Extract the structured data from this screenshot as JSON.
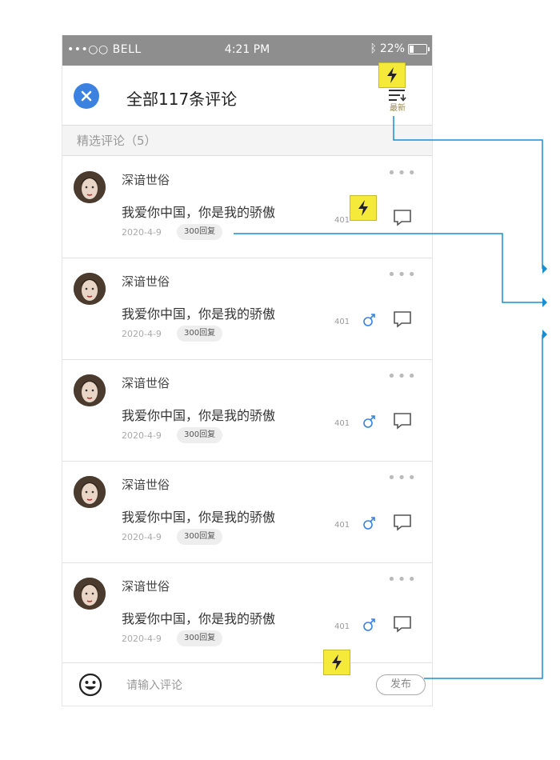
{
  "status_bar": {
    "carrier": "•••○○ BELL",
    "time": "4:21 PM",
    "battery": "22%",
    "battery_level": 0.22
  },
  "header": {
    "title": "全部117条评论",
    "sort_label": "最新"
  },
  "section": {
    "label": "精选评论（5）"
  },
  "comments": [
    {
      "username": "深谙世俗",
      "text": "我爱你中国，你是我的骄傲",
      "date": "2020-4-9",
      "replies": "300回复",
      "likes": "401"
    },
    {
      "username": "深谙世俗",
      "text": "我爱你中国，你是我的骄傲",
      "date": "2020-4-9",
      "replies": "300回复",
      "likes": "401"
    },
    {
      "username": "深谙世俗",
      "text": "我爱你中国，你是我的骄傲",
      "date": "2020-4-9",
      "replies": "300回复",
      "likes": "401"
    },
    {
      "username": "深谙世俗",
      "text": "我爱你中国，你是我的骄傲",
      "date": "2020-4-9",
      "replies": "300回复",
      "likes": "401"
    },
    {
      "username": "深谙世俗",
      "text": "我爱你中国，你是我的骄傲",
      "date": "2020-4-9",
      "replies": "300回复",
      "likes": "401"
    }
  ],
  "footer": {
    "placeholder": "请输入评论",
    "publish_label": "发布"
  },
  "colors": {
    "accent": "#3b82e0",
    "annotation_line": "#1a8fd0",
    "flash_marker": "#f5e93a",
    "status_bar": "#8e8e8e"
  },
  "icons": [
    "close-icon",
    "sort-icon",
    "more-icon",
    "like-icon",
    "reply-icon",
    "emoji-icon",
    "flash-icon",
    "wifi-icon",
    "bluetooth-icon",
    "battery-icon"
  ]
}
